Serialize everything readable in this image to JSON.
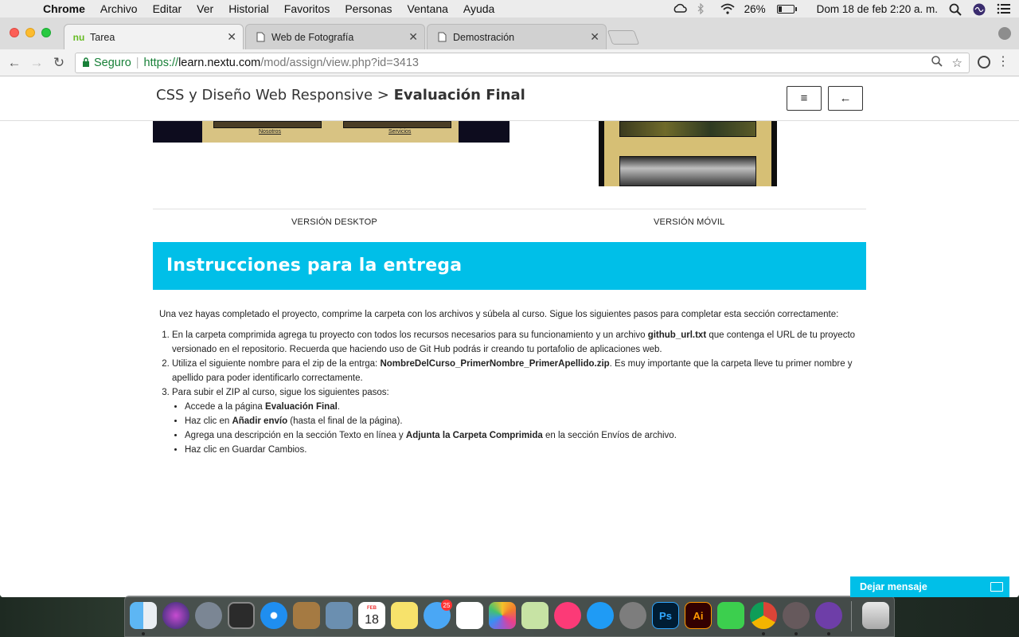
{
  "menubar": {
    "app": "Chrome",
    "items": [
      "Archivo",
      "Editar",
      "Ver",
      "Historial",
      "Favoritos",
      "Personas",
      "Ventana",
      "Ayuda"
    ],
    "battery_percent": "26%",
    "battery_level": 0.26,
    "datetime": "Dom 18 de feb  2:20 a. m."
  },
  "tabs": [
    {
      "label": "Tarea",
      "favicon": "nu-logo"
    },
    {
      "label": "Web de Fotografía",
      "favicon": "page-icon"
    },
    {
      "label": "Demostración",
      "favicon": "page-icon"
    }
  ],
  "omnibox": {
    "secure_label": "Seguro",
    "scheme": "https://",
    "host": "learn.nextu.com",
    "path": "/mod/assign/view.php?id=3413"
  },
  "header": {
    "course": "CSS y Diseño Web Responsive",
    "separator": ">",
    "current": "Evaluación Final",
    "menu_glyph": "≡",
    "back_glyph": "←"
  },
  "preview": {
    "caption_left": "Nosotros",
    "caption_right": "Servicios"
  },
  "versions": {
    "desktop": "VERSIÓN DESKTOP",
    "mobile": "VERSIÓN MÓVIL"
  },
  "banner": {
    "title": "Instrucciones para la entrega"
  },
  "instructions": {
    "intro": "Una vez hayas completado el proyecto, comprime la carpeta con los archivos y súbela al curso. Sigue los siguientes pasos para completar esta sección correctamente:",
    "step1_a": "En la carpeta comprimida agrega tu proyecto con todos los recursos necesarios para su funcionamiento y un archivo ",
    "step1_b": "github_url.txt",
    "step1_c": " que contenga el URL de tu proyecto versionado en el repositorio. Recuerda que haciendo uso de Git Hub podrás ir creando tu portafolio de aplicaciones web.",
    "step2_a": "Utiliza el siguiente nombre para el zip de la entrga: ",
    "step2_b": "NombreDelCurso_PrimerNombre_PrimerApellido.zip",
    "step2_c": ". Es muy importante que la carpeta lleve tu primer nombre y apellido para poder identificarlo correctamente.",
    "step3": "Para subir el ZIP al curso, sigue los siguientes pasos:",
    "sub1_a": "Accede a la página ",
    "sub1_b": "Evaluación Final",
    "sub1_c": ".",
    "sub2_a": "Haz clic en ",
    "sub2_b": "Añadir envío",
    "sub2_c": " (hasta el final de la página).",
    "sub3_a": "Agrega una descripción en la sección Texto en línea y ",
    "sub3_b": "Adjunta la Carpeta Comprimida",
    "sub3_c": " en la sección Envíos de archivo.",
    "sub4": "Haz clic en Guardar Cambios."
  },
  "chat": {
    "label": "Dejar mensaje"
  },
  "dock": {
    "icons": [
      "finder-icon",
      "siri-icon",
      "launchpad-icon",
      "photo-booth-icon",
      "safari-icon",
      "notebook-icon",
      "preview-icon",
      "calendar-icon",
      "notes-icon",
      "messages-icon",
      "reminders-icon",
      "photos-icon",
      "maps-icon",
      "itunes-icon",
      "app-store-icon",
      "system-preferences-icon",
      "photoshop-icon",
      "illustrator-icon",
      "facetime-icon",
      "chrome-icon",
      "atom-icon",
      "github-desktop-icon",
      "trash-icon"
    ],
    "calendar_day": "18",
    "calendar_month": "FEB",
    "messages_badge": "25",
    "photoshop_label": "Ps",
    "illustrator_label": "Ai"
  }
}
